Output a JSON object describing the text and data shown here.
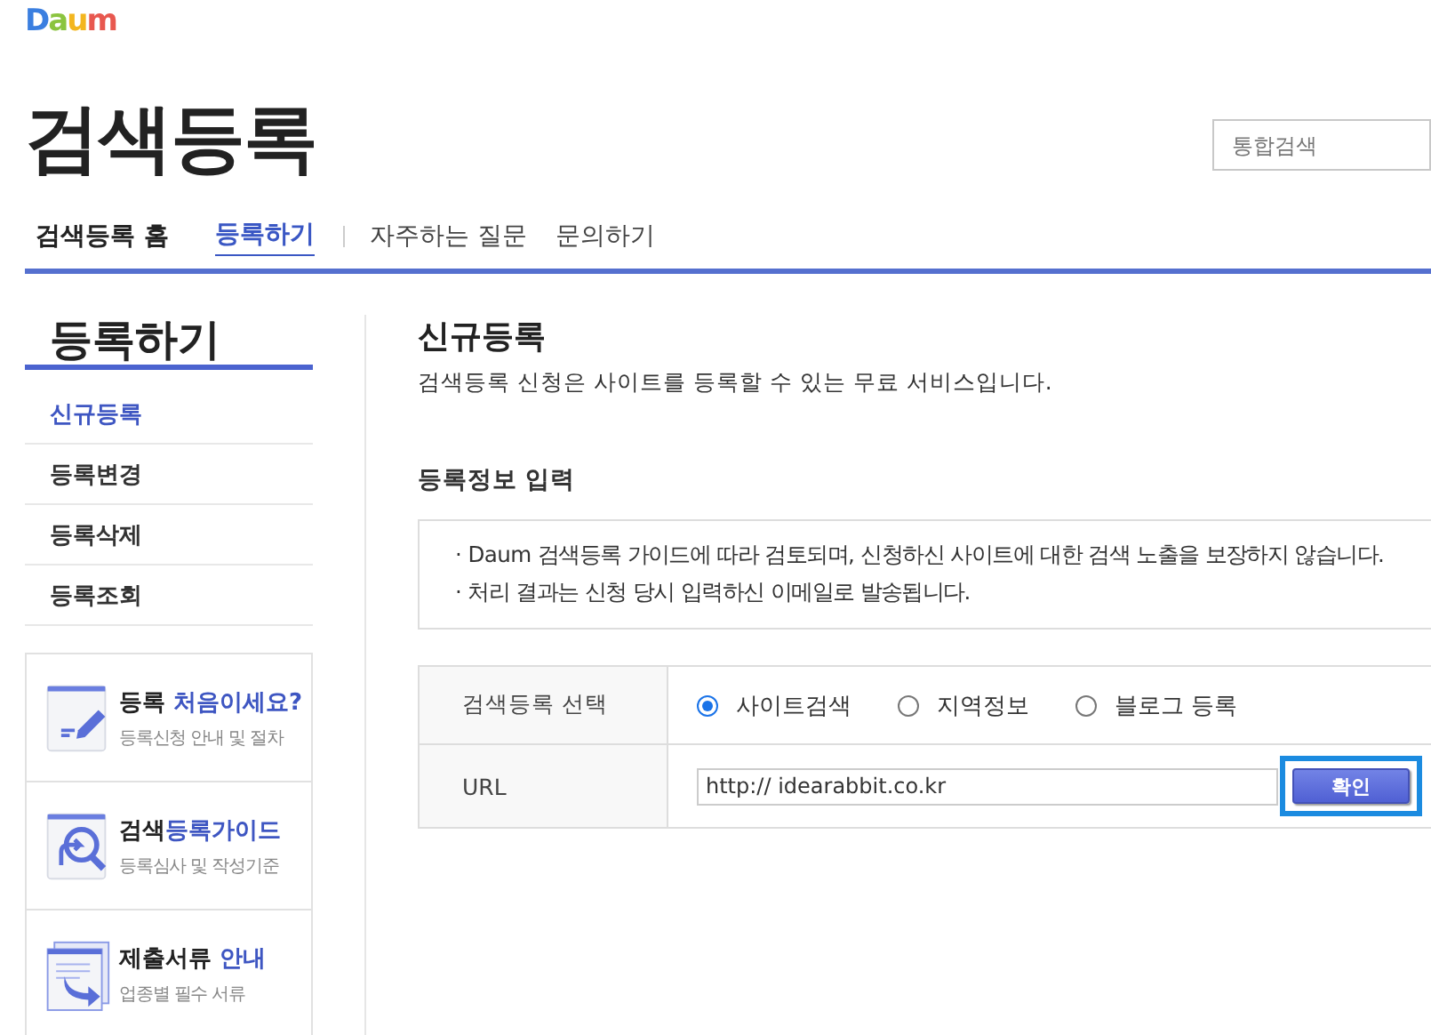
{
  "logo": "Daum",
  "header": {
    "title": "검색등록",
    "search": {
      "placeholder": "통합검색"
    }
  },
  "nav": [
    {
      "label": "검색등록 홈",
      "selected": false,
      "kind": "home"
    },
    {
      "label": "등록하기",
      "selected": true,
      "kind": "link"
    },
    {
      "label": "자주하는 질문",
      "selected": false,
      "kind": "link"
    },
    {
      "label": "문의하기",
      "selected": false,
      "kind": "link"
    }
  ],
  "sidebar": {
    "title": "등록하기",
    "items": [
      {
        "label": "신규등록",
        "selected": true
      },
      {
        "label": "등록변경",
        "selected": false
      },
      {
        "label": "등록삭제",
        "selected": false
      },
      {
        "label": "등록조회",
        "selected": false
      }
    ],
    "promos": [
      {
        "kind": "pencil",
        "title": [
          {
            "text": "등록 ",
            "accent": false
          },
          {
            "text": "처음이세요?",
            "accent": true
          }
        ],
        "subtitle": "등록신청 안내 및 절차"
      },
      {
        "kind": "magnifier",
        "title": [
          {
            "text": "검색",
            "accent": false
          },
          {
            "text": "등록가이드",
            "accent": true
          }
        ],
        "subtitle": "등록심사 및 작성기준"
      },
      {
        "kind": "documents",
        "title": [
          {
            "text": "제출서류 ",
            "accent": false
          },
          {
            "text": "안내",
            "accent": true
          }
        ],
        "subtitle": "업종별 필수 서류"
      }
    ]
  },
  "main": {
    "title": "신규등록",
    "description": "검색등록 신청은 사이트를 등록할 수 있는 무료 서비스입니다.",
    "section_title": "등록정보 입력",
    "notices": [
      "· Daum 검색등록 가이드에 따라 검토되며, 신청하신 사이트에 대한 검색 노출을 보장하지 않습니다.",
      "· 처리 결과는 신청 당시 입력하신 이메일로 발송됩니다."
    ],
    "form": {
      "type_label": "검색등록 선택",
      "options": [
        {
          "label": "사이트검색",
          "selected": true
        },
        {
          "label": "지역정보",
          "selected": false
        },
        {
          "label": "블로그 등록",
          "selected": false
        }
      ],
      "url_label": "URL",
      "url_value": "http:// idearabbit.co.kr",
      "button": {
        "label": "확인",
        "highlighted": true
      }
    }
  }
}
